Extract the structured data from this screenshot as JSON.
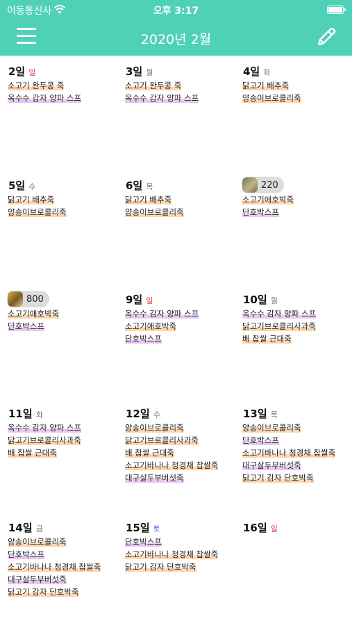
{
  "status": {
    "carrier": "이동통신사",
    "time": "오후 3:17",
    "battery_level": 1.0
  },
  "header": {
    "title": "2020년 2월",
    "menu_icon": "hamburger-icon",
    "edit_icon": "pencil-icon"
  },
  "colors": {
    "header_bg": "#4fd1b8",
    "sunday": "#e04040",
    "saturday": "#3a56d6",
    "meal_orange": "#ffd6ac",
    "meal_purple": "#e9c7f4"
  },
  "days": [
    {
      "day": "2일",
      "weekday": "일",
      "meals": [
        "소고기 완두콩 죽",
        "옥수수 감자 양파 스프"
      ]
    },
    {
      "day": "3일",
      "weekday": "월",
      "meals": [
        "소고기 완두콩 죽",
        "옥수수 감자 양파 스프"
      ]
    },
    {
      "day": "4일",
      "weekday": "화",
      "meals": [
        "닭고기 배추죽",
        "양송이브로콜리죽"
      ]
    },
    {
      "day": "5일",
      "weekday": "수",
      "meals": [
        "닭고기 배추죽",
        "양송이브로콜리죽"
      ]
    },
    {
      "day": "6일",
      "weekday": "목",
      "meals": [
        "닭고기 배추죽",
        "양송이브로콜리죽"
      ]
    },
    {
      "badge": "220",
      "meals": [
        "소고기애호박죽",
        "단호박스프"
      ]
    },
    {
      "badge": "800",
      "meals": [
        "소고기애호박죽",
        "단호박스프"
      ]
    },
    {
      "day": "9일",
      "weekday": "일",
      "meals": [
        "옥수수 감자 양파 스프",
        "소고기애호박죽",
        "단호박스프"
      ]
    },
    {
      "day": "10일",
      "weekday": "월",
      "meals": [
        "옥수수 감자 양파 스프",
        "닭고기브로콜리사과죽",
        "배 찹쌀 근대죽"
      ]
    },
    {
      "day": "11일",
      "weekday": "화",
      "meals": [
        "옥수수 감자 양파 스프",
        "닭고기브로콜리사과죽",
        "배 찹쌀 근대죽"
      ]
    },
    {
      "day": "12일",
      "weekday": "수",
      "meals": [
        "양송이브로콜리죽",
        "닭고기브로콜리사과죽",
        "배 찹쌀 근대죽",
        "소고기바나나 청경채 찹쌀죽",
        "대구살두부버섯죽"
      ]
    },
    {
      "day": "13일",
      "weekday": "목",
      "meals": [
        "양송이브로콜리죽",
        "단호박스프",
        "소고기바나나 청경채 찹쌀죽",
        "대구살두부버섯죽",
        "닭고기 감자 단호박죽"
      ]
    },
    {
      "day": "14일",
      "weekday": "금",
      "meals": [
        "양송이브로콜리죽",
        "단호박스프",
        "소고기바나나 청경채 찹쌀죽",
        "대구살두부버섯죽",
        "닭고기 감자 단호박죽"
      ]
    },
    {
      "day": "15일",
      "weekday": "토",
      "meals": [
        "단호박스프",
        "소고기바나나 청경채 찹쌀죽",
        "닭고기 감자 단호박죽"
      ]
    },
    {
      "day": "16일",
      "weekday": "일",
      "meals": []
    }
  ]
}
